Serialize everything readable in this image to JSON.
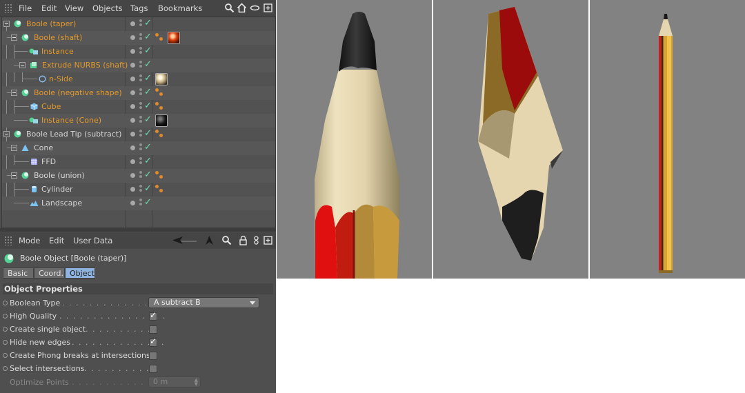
{
  "object_manager": {
    "menu": [
      "File",
      "Edit",
      "View",
      "Objects",
      "Tags",
      "Bookmarks"
    ],
    "objects": [
      {
        "name": "Boole (taper)",
        "color": "#e39a2b",
        "icon": "boole-icon"
      },
      {
        "name": "Boole (shaft)",
        "color": "#e39a2b",
        "icon": "boole-icon"
      },
      {
        "name": "Instance",
        "color": "#e39a2b",
        "icon": "instance-icon"
      },
      {
        "name": "Extrude NURBS (shaft)",
        "color": "#e39a2b",
        "icon": "extrude-nurbs-icon"
      },
      {
        "name": "n-Side",
        "color": "#e39a2b",
        "icon": "n-side-spline-icon"
      },
      {
        "name": "Boole (negative shape)",
        "color": "#e39a2b",
        "icon": "boole-icon"
      },
      {
        "name": "Cube",
        "color": "#e39a2b",
        "icon": "cube-icon"
      },
      {
        "name": "Instance (Cone)",
        "color": "#e39a2b",
        "icon": "instance-icon"
      },
      {
        "name": "Boole Lead Tip (subtract)",
        "color": "#d6d6d6",
        "icon": "boole-icon"
      },
      {
        "name": "Cone",
        "color": "#d6d6d6",
        "icon": "cone-icon"
      },
      {
        "name": "FFD",
        "color": "#d6d6d6",
        "icon": "ffd-icon"
      },
      {
        "name": "Boole (union)",
        "color": "#d6d6d6",
        "icon": "boole-icon"
      },
      {
        "name": "Cylinder",
        "color": "#d6d6d6",
        "icon": "cylinder-icon"
      },
      {
        "name": "Landscape",
        "color": "#d6d6d6",
        "icon": "landscape-icon"
      }
    ]
  },
  "attribute_manager": {
    "menu": [
      "Mode",
      "Edit",
      "User Data"
    ],
    "title": "Boole Object [Boole (taper)]",
    "tabs": [
      "Basic",
      "Coord.",
      "Object"
    ],
    "active_tab": "Object",
    "section": "Object Properties",
    "properties": {
      "boolean_type": {
        "label": "Boolean Type",
        "value": "A subtract B"
      },
      "high_quality": {
        "label": "High Quality",
        "checked": true
      },
      "create_single_object": {
        "label": "Create single object",
        "checked": false
      },
      "hide_new_edges": {
        "label": "Hide new edges",
        "checked": true
      },
      "create_phong_breaks": {
        "label": "Create Phong breaks at intersections",
        "checked": false
      },
      "select_intersections": {
        "label": "Select intersections",
        "checked": false
      },
      "optimize_points": {
        "label": "Optimize Points",
        "value": "0 m",
        "enabled": false
      }
    }
  },
  "colors": {
    "panel": "#4f4f4f",
    "active_object_text": "#e39a2b",
    "active_tab": "#8fb4e0",
    "viewport_bg": "#828282",
    "check_mark": "#6fe0b0"
  }
}
